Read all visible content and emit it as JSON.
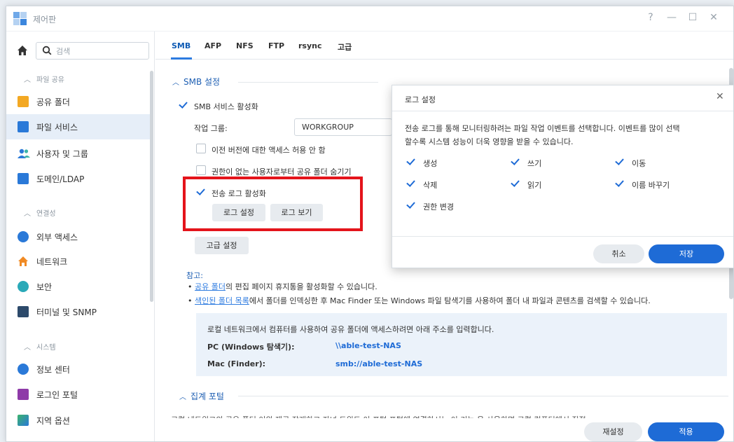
{
  "window": {
    "title": "제어판",
    "controls": [
      "?",
      "—",
      "☐",
      "✕"
    ]
  },
  "sidebar": {
    "search_placeholder": "검색",
    "sections": [
      {
        "label": "파일 공유"
      },
      {
        "label": "연결성"
      },
      {
        "label": "시스템"
      }
    ],
    "items": [
      {
        "label": "공유 폴더"
      },
      {
        "label": "파일 서비스"
      },
      {
        "label": "사용자 및 그룹"
      },
      {
        "label": "도메인/LDAP"
      },
      {
        "label": "외부 액세스"
      },
      {
        "label": "네트워크"
      },
      {
        "label": "보안"
      },
      {
        "label": "터미널 및 SNMP"
      },
      {
        "label": "정보 센터"
      },
      {
        "label": "로그인 포털"
      },
      {
        "label": "지역 옵션"
      }
    ]
  },
  "tabs": [
    "SMB",
    "AFP",
    "NFS",
    "FTP",
    "rsync",
    "고급"
  ],
  "smb": {
    "section_title": "SMB 설정",
    "enable_label": "SMB 서비스 활성화",
    "workgroup_label": "작업 그룹:",
    "workgroup_value": "WORKGROUP",
    "prev_version_label": "이전 버전에 대한 액세스 허용 안 함",
    "hide_label": "권한이 없는 사용자로부터 공유 폴더 숨기기",
    "transfer_log_label": "전송 로그 활성화",
    "log_settings_button": "로그 설정",
    "log_view_button": "로그 보기",
    "advanced_button": "고급 설정",
    "note_title": "참고:",
    "note1_link": "공유 폴더",
    "note1_text": "의 편집 페이지 휴지통을 활성화할 수 있습니다.",
    "note2_link": "색인된 폴더 목록",
    "note2_text": "에서 폴더를 인덱싱한 후 Mac Finder 또는 Windows 파일 탐색기를 사용하여 폴더 내 파일과 콘텐츠를 검색할 수 있습니다.",
    "info_text": "로컬 네트워크에서 컴퓨터를 사용하여 공유 폴더에 액세스하려면 아래 주소를 입력합니다.",
    "pc_label": "PC (Windows 탐색기):",
    "pc_value": "\\\\able-test-NAS",
    "mac_label": "Mac (Finder):",
    "mac_value": "smb://able-test-NAS"
  },
  "portal": {
    "section_title": "집계 포털",
    "cut_text": "로컬 네트워크의 공유 폴더 이외 제공 장래하고 자녀 트위트 이 포털 포털에 연결하시는 이 기능 을 사용하면 로컬 컴퓨터에서 직접 폴더 공유 폴더"
  },
  "footer": {
    "reset_button": "재설정",
    "apply_button": "적용"
  },
  "dialog": {
    "title": "로그 설정",
    "description_line1": "전송 로그를 통해 모니터링하려는 파일 작업 이벤트를 선택합니다. 이벤트를 많이 선택",
    "description_line2": "할수록 시스템 성능이 더욱 영향을 받을 수 있습니다.",
    "events": [
      "생성",
      "쓰기",
      "이동",
      "삭제",
      "읽기",
      "이름 바꾸기",
      "권한 변경"
    ],
    "cancel_button": "취소",
    "save_button": "저장"
  },
  "colors": {
    "accent": "#1e6bd6",
    "highlight_box": "#e4141b"
  }
}
